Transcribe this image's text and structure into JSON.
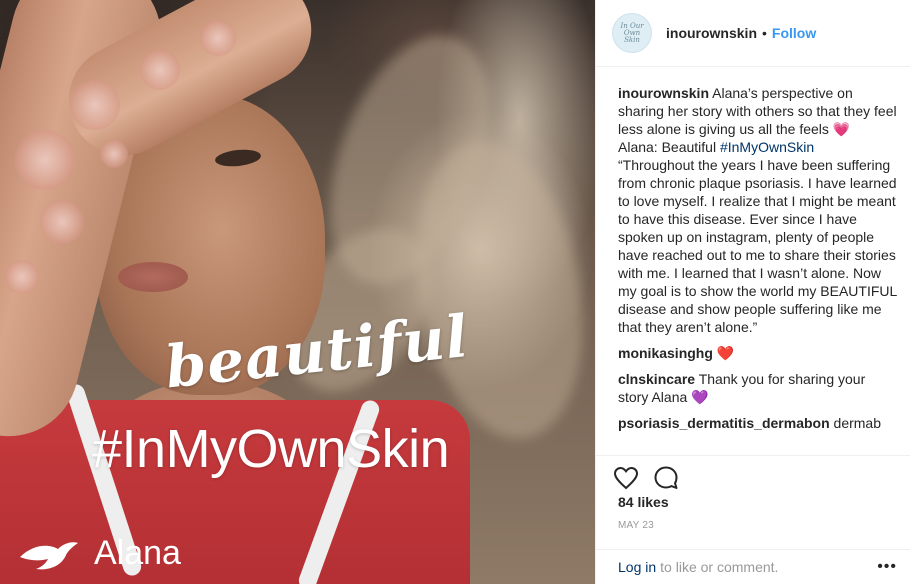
{
  "post": {
    "image_overlay": {
      "script_text": "beautiful",
      "hashtag": "#InMyOwnSkin",
      "brand_name": "Alana"
    }
  },
  "header": {
    "avatar_text": "In Our Own Skin",
    "username": "inourownskin",
    "separator": "•",
    "follow_label": "Follow"
  },
  "caption": {
    "username": "inourownskin",
    "text_1": "Alana’s perspective on sharing her story with others so that they feel less alone is giving us all the feels",
    "emoji_1": "💗",
    "text_2": "Alana: Beautiful",
    "hashtag": "#InMyOwnSkin",
    "quote": "“Throughout the years I have been suffering from chronic plaque psoriasis. I have learned to love myself. I realize that I might be meant to have this disease. Ever since I have spoken up on instagram, plenty of people have reached out to me to share their stories with me. I learned that I wasn’t alone. Now my goal is to show the world my BEAUTIFUL disease and show people suffering like me that they aren’t alone.”"
  },
  "comments": [
    {
      "username": "monikasinghg",
      "text": "",
      "emoji": "❤️"
    },
    {
      "username": "clnskincare",
      "text": "Thank you for sharing your story Alana",
      "emoji": "💜"
    },
    {
      "username": "psoriasis_dermatitis_dermabon",
      "text": "dermab",
      "emoji": ""
    }
  ],
  "actions": {
    "like_icon": "heart-outline-icon",
    "comment_icon": "speech-bubble-icon",
    "likes": "84 likes",
    "date": "MAY 23"
  },
  "footer": {
    "login_label": "Log in",
    "login_suffix": "to like or comment.",
    "more_label": "•••"
  }
}
